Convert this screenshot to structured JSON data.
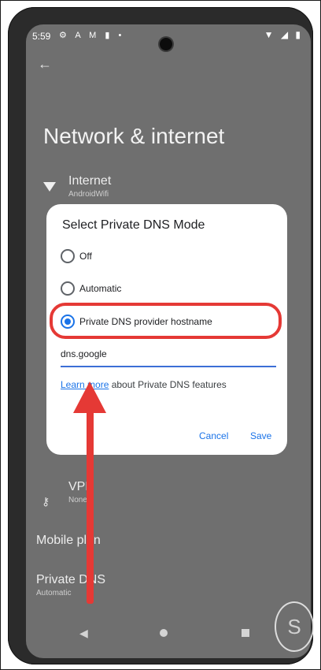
{
  "status_bar": {
    "time": "5:59",
    "icons": [
      "gear-icon",
      "translate-icon",
      "mail-icon",
      "battery-saver-icon",
      "dot-icon"
    ],
    "right_icons": [
      "wifi-icon",
      "signal-icon",
      "battery-icon"
    ]
  },
  "header": {
    "back_glyph": "←",
    "title": "Network & internet"
  },
  "settings": {
    "internet": {
      "label": "Internet",
      "sub": "AndroidWifi"
    },
    "vpn": {
      "label": "VPN",
      "sub": "None"
    },
    "mobile_plan": {
      "label": "Mobile plan"
    },
    "private_dns": {
      "label": "Private DNS",
      "sub": "Automatic"
    }
  },
  "dialog": {
    "title": "Select Private DNS Mode",
    "options": [
      "Off",
      "Automatic",
      "Private DNS provider hostname"
    ],
    "selected_index": 2,
    "hostname_value": "dns.google",
    "learn_more_link": "Learn more",
    "learn_more_rest": " about Private DNS features",
    "cancel_label": "Cancel",
    "save_label": "Save"
  },
  "annotation": {
    "highlight_color": "#e53935",
    "arrow_color": "#e53935"
  },
  "colors": {
    "accent": "#1a73e8",
    "dim_overlay": "#6f6f6f"
  }
}
